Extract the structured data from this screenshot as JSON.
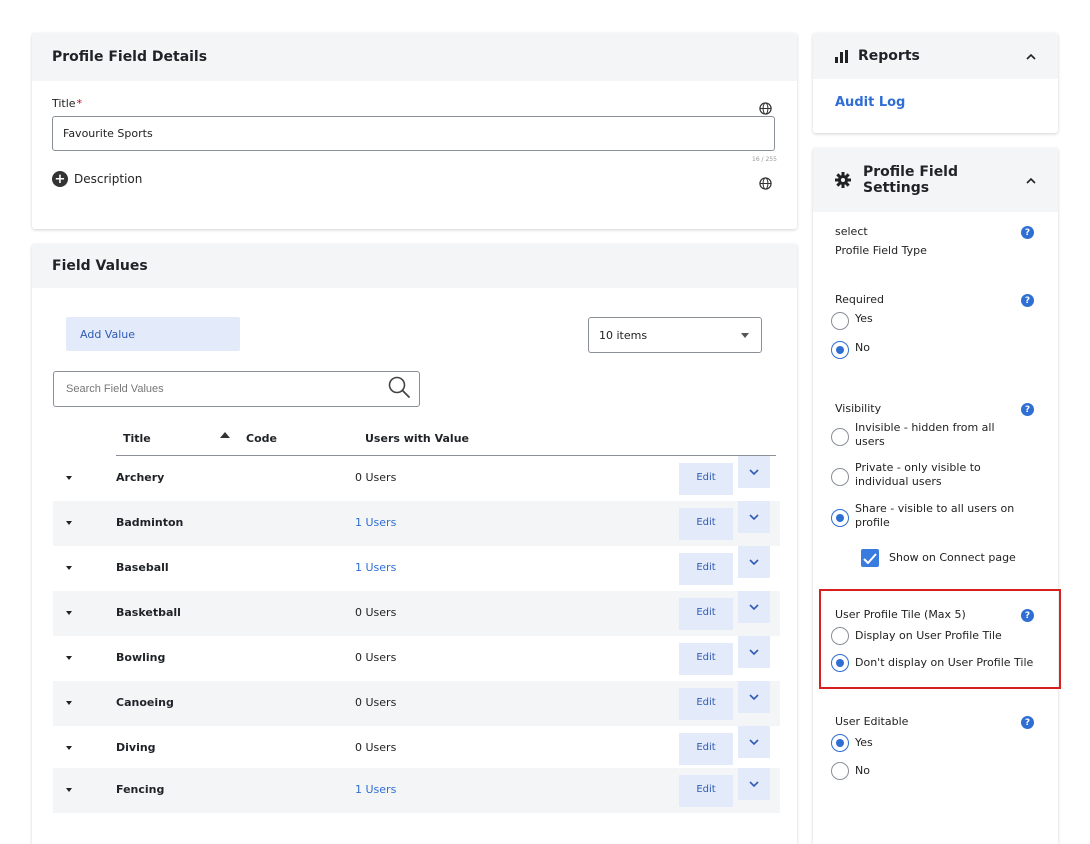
{
  "details": {
    "header": "Profile Field Details",
    "title_label": "Title",
    "required_mark": "*",
    "title_value": "Favourite Sports",
    "char_count": "16 / 255",
    "description_label": "Description"
  },
  "values": {
    "header": "Field Values",
    "add_button": "Add Value",
    "page_size": "10 items",
    "search_placeholder": "Search Field Values",
    "columns": {
      "title": "Title",
      "code": "Code",
      "users": "Users with Value"
    },
    "edit_label": "Edit",
    "rows": [
      {
        "title": "Archery",
        "users": "0 Users"
      },
      {
        "title": "Badminton",
        "users": "1 Users"
      },
      {
        "title": "Baseball",
        "users": "1 Users"
      },
      {
        "title": "Basketball",
        "users": "0 Users"
      },
      {
        "title": "Bowling",
        "users": "0 Users"
      },
      {
        "title": "Canoeing",
        "users": "0 Users"
      },
      {
        "title": "Diving",
        "users": "0 Users"
      },
      {
        "title": "Fencing",
        "users": "1 Users"
      }
    ]
  },
  "reports": {
    "header": "Reports",
    "audit_log": "Audit Log"
  },
  "settings": {
    "header_line1": "Profile Field",
    "header_line2": "Settings",
    "type_value": "select",
    "type_label": "Profile Field Type",
    "required": {
      "label": "Required",
      "yes": "Yes",
      "no": "No",
      "selected": "No"
    },
    "visibility": {
      "label": "Visibility",
      "invisible_1": "Invisible - hidden from all",
      "invisible_2": "users",
      "private_1": "Private - only visible to",
      "private_2": "individual users",
      "share_1": "Share - visible to all users on",
      "share_2": "profile",
      "selected": "Share",
      "show_connect": "Show on Connect page",
      "show_connect_checked": true
    },
    "tile": {
      "label": "User Profile Tile (Max 5)",
      "display": "Display on User Profile Tile",
      "dont_display": "Don't display on User Profile Tile",
      "selected": "Don't display on User Profile Tile"
    },
    "editable": {
      "label": "User Editable",
      "yes": "Yes",
      "no": "No",
      "selected": "Yes"
    },
    "help_glyph": "?"
  },
  "colors": {
    "accent": "#2f6ed3",
    "button_bg": "#e3ebfa",
    "highlight": "#d92020",
    "required": "#d0021b"
  }
}
